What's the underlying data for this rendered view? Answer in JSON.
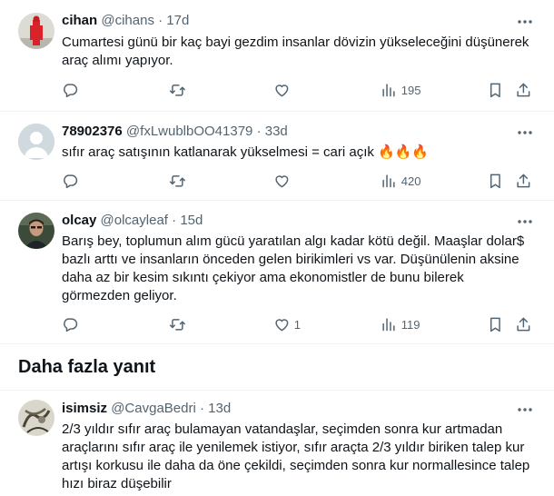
{
  "tweets": [
    {
      "name": "cihan",
      "handle": "@cihans",
      "dot": "·",
      "time": "17d",
      "text": "Cumartesi günü bir kaç bayi gezdim insanlar dövizin yükseleceğini düşünerek araç alımı yapıyor.",
      "views": "195",
      "likes": "",
      "avatar": "red-figure"
    },
    {
      "name": "78902376",
      "handle": "@fxLwublbOO41379",
      "dot": "·",
      "time": "33d",
      "text": "sıfır araç satışının katlanarak yükselmesi = cari açık 🔥🔥🔥",
      "views": "420",
      "likes": "",
      "avatar": "default-person"
    },
    {
      "name": "olcay",
      "handle": "@olcayleaf",
      "dot": "·",
      "time": "15d",
      "text": "Barış bey, toplumun alım gücü yaratılan algı kadar kötü değil. Maaşlar dolar$ bazlı arttı ve insanların önceden gelen birikimleri vs var. Düşünülenin aksine daha az bir kesim sıkıntı çekiyor ama ekonomistler de bunu bilerek görmezden geliyor.",
      "views": "119",
      "likes": "1",
      "avatar": "man-photo"
    },
    {
      "name": "isimsiz",
      "handle": "@CavgaBedri",
      "dot": "·",
      "time": "13d",
      "text": "2/3 yıldır sıfır araç bulamayan vatandaşlar, seçimden sonra kur artmadan araçlarını sıfır araç ile yenilemek istiyor, sıfır araçta 2/3 yıldır biriken talep kur artışı korkusu ile daha da öne çekildi, seçimden sonra kur normallesince talep hızı biraz düşebilir",
      "avatar": "scribble-photo"
    }
  ],
  "more_replies_heading": "Daha fazla yanıt",
  "icons": [
    "reply-icon",
    "retweet-icon",
    "like-icon",
    "views-icon",
    "bookmark-icon",
    "share-icon",
    "more-icon"
  ],
  "colors": {
    "text": "#0f1419",
    "secondary": "#536471",
    "border": "#eff3f4"
  }
}
